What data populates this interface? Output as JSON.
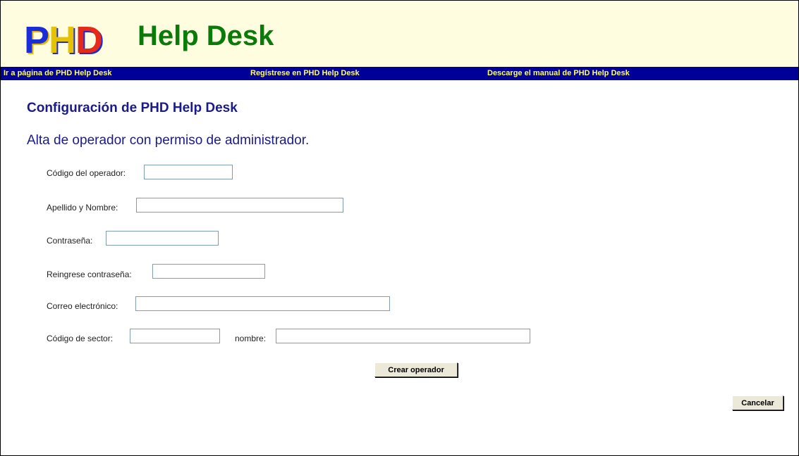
{
  "header": {
    "logo": {
      "p": "P",
      "h": "H",
      "d": "D"
    },
    "title": "Help Desk"
  },
  "nav": {
    "home_link": "Ir a página de PHD Help Desk",
    "register_link": "Regístrese en PHD Help Desk",
    "manual_link": "Descarge el manual de PHD Help Desk"
  },
  "main": {
    "heading": "Configuración de PHD Help Desk",
    "subheading": "Alta de operador con permiso de administrador."
  },
  "form": {
    "operator_code": {
      "label": "Código del operador:",
      "value": ""
    },
    "full_name": {
      "label": "Apellido y Nombre:",
      "value": ""
    },
    "password": {
      "label": "Contraseña:",
      "value": ""
    },
    "password_confirm": {
      "label": "Reingrese contraseña:",
      "value": ""
    },
    "email": {
      "label": "Correo electrónico:",
      "value": ""
    },
    "sector_code": {
      "label": "Código de sector:",
      "value": ""
    },
    "sector_name": {
      "label": "nombre:",
      "value": ""
    },
    "create_button": "Crear operador",
    "cancel_button": "Cancelar"
  },
  "colors": {
    "header_bg": "#fffde0",
    "navbar_bg": "#000099",
    "nav_link": "#ffff66",
    "title_green": "#0a7a0a",
    "heading_blue": "#1a1a8c"
  }
}
